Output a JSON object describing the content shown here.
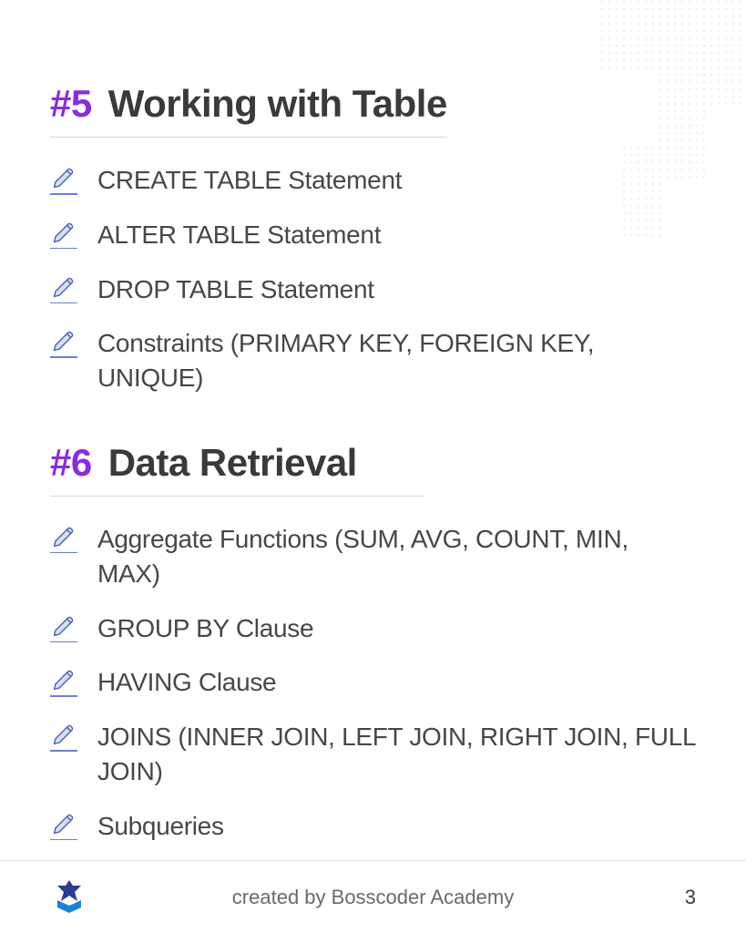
{
  "sections": [
    {
      "number": "#5",
      "title": "Working with Table",
      "items": [
        "CREATE TABLE Statement",
        "ALTER TABLE Statement",
        "DROP TABLE Statement",
        "Constraints (PRIMARY KEY, FOREIGN KEY, UNIQUE)"
      ]
    },
    {
      "number": "#6",
      "title": "Data Retrieval",
      "items": [
        "Aggregate Functions (SUM, AVG, COUNT, MIN, MAX)",
        "GROUP BY Clause",
        "HAVING Clause",
        "JOINS (INNER JOIN, LEFT JOIN, RIGHT JOIN, FULL JOIN)",
        "Subqueries"
      ]
    }
  ],
  "footer": {
    "credit": "created by Bosscoder Academy",
    "page": "3"
  }
}
